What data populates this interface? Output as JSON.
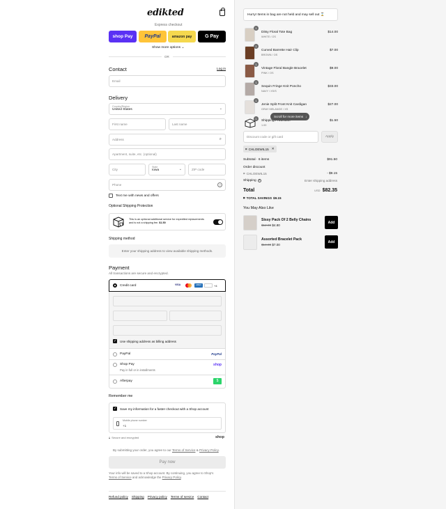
{
  "header": {
    "logo_text": "edikted",
    "bag_icon": "shopping-bag-icon"
  },
  "express": {
    "label": "Express checkout",
    "shop_pay_label": "shop Pay",
    "paypal_label": "PayPal",
    "amazon_pay_label": "amazon pay",
    "gpay_label": "G Pay",
    "show_more": "Show more options ⌄",
    "or_label": "OR"
  },
  "contact": {
    "title": "Contact",
    "login_link": "Log in",
    "email_placeholder": "Email"
  },
  "delivery": {
    "title": "Delivery",
    "country_label": "Country/Region",
    "country_value": "United States",
    "first_name": "First name",
    "last_name": "Last name",
    "address": "Address",
    "apartment": "Apartment, suite, etc. (optional)",
    "city": "City",
    "state_label": "State",
    "state_value": "Iowa",
    "zip": "ZIP code",
    "phone": "Phone",
    "text_me": "Text me with news and offers"
  },
  "protection": {
    "title": "Optional Shipping Protection",
    "text_line1": "This is an optional additional service for expedited replacements",
    "text_line2": "and is not a shipping fee. ",
    "price": "$1.50"
  },
  "shipping_method": {
    "title": "Shipping method",
    "message": "Enter your shipping address to view available shipping methods."
  },
  "payment": {
    "title": "Payment",
    "subtitle": "All transactions are secure and encrypted.",
    "credit_card": "Credit card",
    "card_more": "+4",
    "billing_same": "Use shipping address as billing address",
    "paypal": "PayPal",
    "paypal_logo": "PayPal",
    "shop_pay": "Shop Pay",
    "shop_pay_sub": "Pay in full or in installments",
    "shop_logo": "shop",
    "afterpay": "Afterpay",
    "afterpay_badge": "$",
    "visa_label": "VISA",
    "amex_label": "AMEX"
  },
  "remember": {
    "title": "Remember me",
    "save_info": "Save my information for a faster checkout with a Shop account",
    "mobile_label": "Mobile phone number",
    "mobile_prefix": "+1",
    "secure": "Secure and encrypted",
    "shop_logo": "shop"
  },
  "legal": {
    "agree_prefix": "By submitting your order, you agree to our ",
    "terms": "Terms of Service",
    "amp": " & ",
    "privacy": "Privacy Policy",
    "agree_suffix": ".",
    "pay_now": "Pay now",
    "shop_info_line1": "Your info will be saved to a Shop account. By continuing, you agree to Shop's",
    "shop_terms": "Terms of Service",
    "shop_info_mid": " and acknowledge the ",
    "shop_privacy": "Privacy Policy",
    "shop_info_end": "."
  },
  "footer": {
    "links": [
      "Refund policy",
      "Shipping",
      "Privacy policy",
      "Terms of service",
      "Contact"
    ]
  },
  "summary": {
    "hurry": "Hurry! Items in bag are not held and may sell out ⌛",
    "items": [
      {
        "name": "Ditsy Floral Tote Bag",
        "variant": "WHITE / OS",
        "price": "$14.00",
        "qty": "1",
        "color": "#d8cfc3"
      },
      {
        "name": "Curved Barrette Hair Clip",
        "variant": "BROWN / OS",
        "price": "$7.00",
        "qty": "1",
        "color": "#6b3e24"
      },
      {
        "name": "Vintage Floral Bangle Bracelet",
        "variant": "PINK / OS",
        "price": "$9.00",
        "qty": "1",
        "color": "#8a5a45"
      },
      {
        "name": "Sequin Fringe Knit Poncho",
        "variant": "NAVY / XS/S",
        "price": "$33.00",
        "qty": "1",
        "color": "#b4aaa6"
      },
      {
        "name": "Jenie Split Front Knit Cardigan",
        "variant": "GRAY MELANGE / XS",
        "price": "$27.00",
        "qty": "1",
        "color": "#e5e0dc"
      },
      {
        "name": "Shipping Protection",
        "variant": "1.00",
        "price": "$1.50",
        "qty": "1",
        "color": "#ffffff"
      }
    ],
    "scroll_tip": "Scroll for more items",
    "discount_placeholder": "Discount code or gift card",
    "apply": "Apply",
    "code_chip": "CHLOEWIL15",
    "subtotal_label": "Subtotal · 6 items",
    "subtotal_value": "$91.50",
    "order_discount_label": "Order discount",
    "order_discount_code": "CHLOEWIL15",
    "order_discount_value": "- $9.15",
    "shipping_label": "Shipping",
    "shipping_value": "Enter shipping address",
    "total_label": "Total",
    "currency": "USD",
    "total_value": "$82.35",
    "savings_label": "TOTAL SAVINGS",
    "savings_value": "$9.15"
  },
  "also_like": {
    "title": "You May Also Like",
    "items": [
      {
        "name": "Sissy Pack Of 2 Belly Chains",
        "old_price": "$12.00",
        "price": "$4.80",
        "add": "Add"
      },
      {
        "name": "Assorted Bracelet Pack",
        "old_price": "$14.00",
        "price": "$7.00",
        "add": "Add"
      }
    ]
  },
  "colors": {
    "shop_pay": "#5a31f4",
    "paypal": "#ffc439",
    "amazon": "#f5d84e",
    "gpay": "#000000",
    "accent": "#111111"
  }
}
